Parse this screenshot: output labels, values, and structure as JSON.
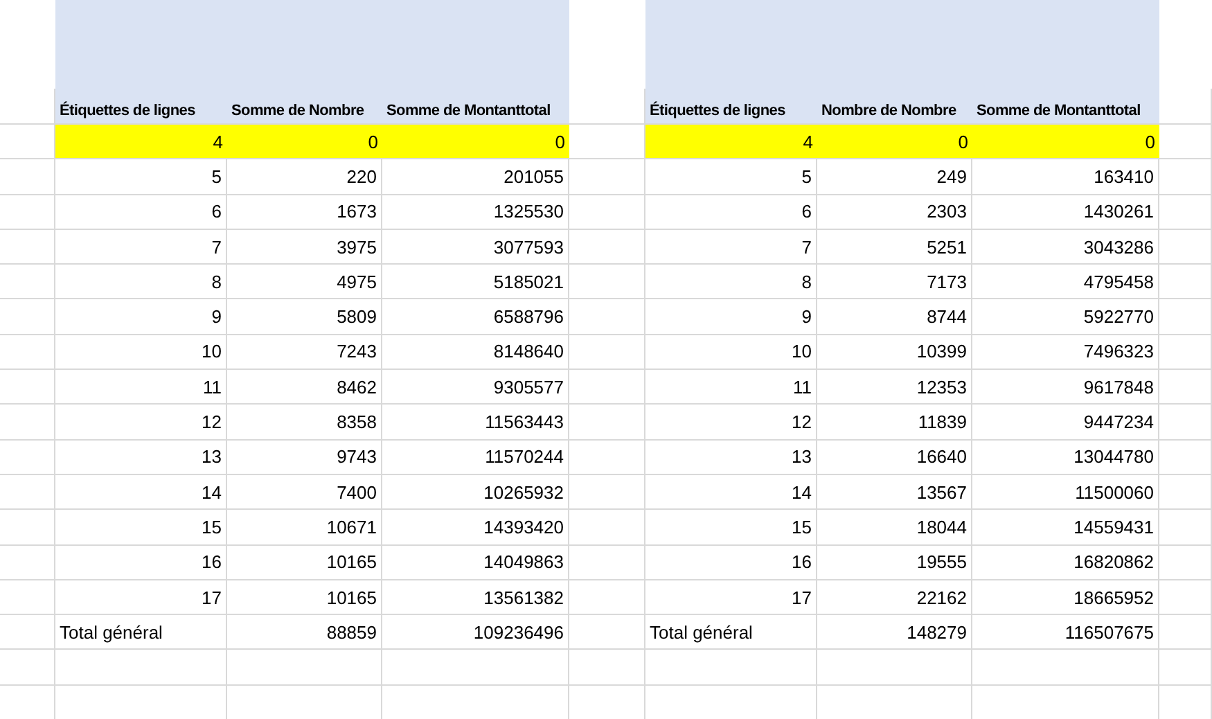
{
  "tables": [
    {
      "columns": [
        "Étiquettes de lignes",
        "Somme de Nombre",
        "Somme de Montanttotal"
      ],
      "rows": [
        {
          "label": "4",
          "values": [
            "0",
            "0"
          ],
          "highlighted": true
        },
        {
          "label": "5",
          "values": [
            "220",
            "201055"
          ],
          "highlighted": false
        },
        {
          "label": "6",
          "values": [
            "1673",
            "1325530"
          ],
          "highlighted": false
        },
        {
          "label": "7",
          "values": [
            "3975",
            "3077593"
          ],
          "highlighted": false
        },
        {
          "label": "8",
          "values": [
            "4975",
            "5185021"
          ],
          "highlighted": false
        },
        {
          "label": "9",
          "values": [
            "5809",
            "6588796"
          ],
          "highlighted": false
        },
        {
          "label": "10",
          "values": [
            "7243",
            "8148640"
          ],
          "highlighted": false
        },
        {
          "label": "11",
          "values": [
            "8462",
            "9305577"
          ],
          "highlighted": false
        },
        {
          "label": "12",
          "values": [
            "8358",
            "11563443"
          ],
          "highlighted": false
        },
        {
          "label": "13",
          "values": [
            "9743",
            "11570244"
          ],
          "highlighted": false
        },
        {
          "label": "14",
          "values": [
            "7400",
            "10265932"
          ],
          "highlighted": false
        },
        {
          "label": "15",
          "values": [
            "10671",
            "14393420"
          ],
          "highlighted": false
        },
        {
          "label": "16",
          "values": [
            "10165",
            "14049863"
          ],
          "highlighted": false
        },
        {
          "label": "17",
          "values": [
            "10165",
            "13561382"
          ],
          "highlighted": false
        }
      ],
      "total": {
        "label": "Total général",
        "values": [
          "88859",
          "109236496"
        ]
      }
    },
    {
      "columns": [
        "Étiquettes de lignes",
        "Nombre de Nombre",
        "Somme de Montanttotal"
      ],
      "rows": [
        {
          "label": "4",
          "values": [
            "0",
            "0"
          ],
          "highlighted": true
        },
        {
          "label": "5",
          "values": [
            "249",
            "163410"
          ],
          "highlighted": false
        },
        {
          "label": "6",
          "values": [
            "2303",
            "1430261"
          ],
          "highlighted": false
        },
        {
          "label": "7",
          "values": [
            "5251",
            "3043286"
          ],
          "highlighted": false
        },
        {
          "label": "8",
          "values": [
            "7173",
            "4795458"
          ],
          "highlighted": false
        },
        {
          "label": "9",
          "values": [
            "8744",
            "5922770"
          ],
          "highlighted": false
        },
        {
          "label": "10",
          "values": [
            "10399",
            "7496323"
          ],
          "highlighted": false
        },
        {
          "label": "11",
          "values": [
            "12353",
            "9617848"
          ],
          "highlighted": false
        },
        {
          "label": "12",
          "values": [
            "11839",
            "9447234"
          ],
          "highlighted": false
        },
        {
          "label": "13",
          "values": [
            "16640",
            "13044780"
          ],
          "highlighted": false
        },
        {
          "label": "14",
          "values": [
            "13567",
            "11500060"
          ],
          "highlighted": false
        },
        {
          "label": "15",
          "values": [
            "18044",
            "14559431"
          ],
          "highlighted": false
        },
        {
          "label": "16",
          "values": [
            "19555",
            "16820862"
          ],
          "highlighted": false
        },
        {
          "label": "17",
          "values": [
            "22162",
            "18665952"
          ],
          "highlighted": false
        }
      ],
      "total": {
        "label": "Total général",
        "values": [
          "148279",
          "116507675"
        ]
      }
    }
  ]
}
